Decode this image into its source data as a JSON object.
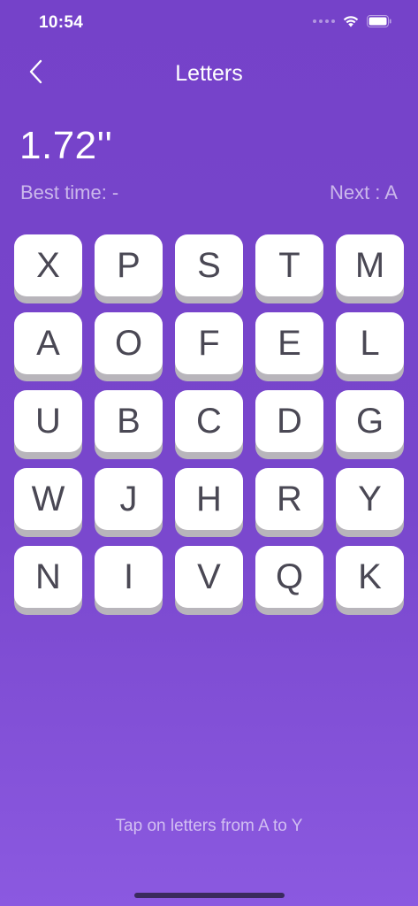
{
  "status_bar": {
    "time": "10:54",
    "icons": [
      "signal-dots-icon",
      "wifi-icon",
      "battery-icon"
    ]
  },
  "nav": {
    "back_icon": "chevron-left-icon",
    "title": "Letters"
  },
  "game": {
    "timer": "1.72''",
    "best_time": "Best time: -",
    "next": "Next : A",
    "tiles": [
      "X",
      "P",
      "S",
      "T",
      "M",
      "A",
      "O",
      "F",
      "E",
      "L",
      "U",
      "B",
      "C",
      "D",
      "G",
      "W",
      "J",
      "H",
      "R",
      "Y",
      "N",
      "I",
      "V",
      "Q",
      "K"
    ]
  },
  "footer": {
    "hint": "Tap on letters from A to Y"
  },
  "colors": {
    "background_top": "#7542c9",
    "background_bottom": "#8b59e0",
    "tile_face": "#ffffff",
    "tile_shadow": "#b8b5bb",
    "tile_text": "#4a4854"
  }
}
